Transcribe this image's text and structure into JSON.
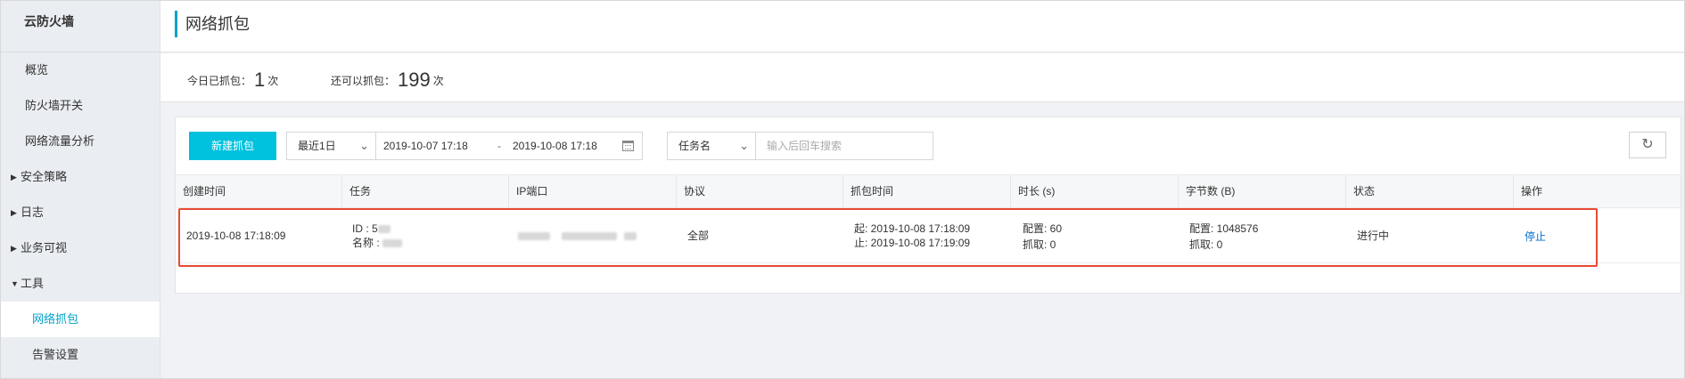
{
  "sidebar": {
    "title": "云防火墙",
    "items": [
      {
        "label": "概览",
        "type": "item"
      },
      {
        "label": "防火墙开关",
        "type": "item"
      },
      {
        "label": "网络流量分析",
        "type": "item"
      },
      {
        "label": "安全策略",
        "type": "group",
        "caret": "▶"
      },
      {
        "label": "日志",
        "type": "group",
        "caret": "▶"
      },
      {
        "label": "业务可视",
        "type": "group",
        "caret": "▶"
      },
      {
        "label": "工具",
        "type": "group",
        "caret": "▼"
      },
      {
        "label": "网络抓包",
        "type": "sub",
        "active": true
      },
      {
        "label": "告警设置",
        "type": "sub"
      }
    ]
  },
  "header": {
    "title": "网络抓包"
  },
  "stats": {
    "today_label": "今日已抓包：",
    "today_value": "1",
    "today_unit": "次",
    "remaining_label": "还可以抓包：",
    "remaining_value": "199",
    "remaining_unit": "次"
  },
  "toolbar": {
    "new_button": "新建抓包",
    "range_select": "最近1日",
    "date_start": "2019-10-07 17:18",
    "date_sep": "-",
    "date_end": "2019-10-08 17:18",
    "filter_select": "任务名",
    "search_placeholder": "输入后回车搜索",
    "refresh_icon": "↻"
  },
  "table": {
    "columns": [
      "创建时间",
      "任务",
      "IP端口",
      "协议",
      "抓包时间",
      "时长 (s)",
      "字节数 (B)",
      "状态",
      "操作"
    ],
    "rows": [
      {
        "created": "2019-10-08 17:18:09",
        "task_id": "ID : 5",
        "task_name": "名称 :",
        "protocol": "全部",
        "capture_start": "起: 2019-10-08 17:18:09",
        "capture_end": "止: 2019-10-08 17:19:09",
        "duration_config": "配置: 60",
        "duration_captured": "抓取: 0",
        "bytes_config": "配置: 1048576",
        "bytes_captured": "抓取: 0",
        "status": "进行中",
        "action": "停止"
      }
    ]
  },
  "colors": {
    "accent": "#00c1de",
    "link": "#0070cc",
    "highlight": "#e84a34",
    "active_nav": "#00a2ca"
  }
}
